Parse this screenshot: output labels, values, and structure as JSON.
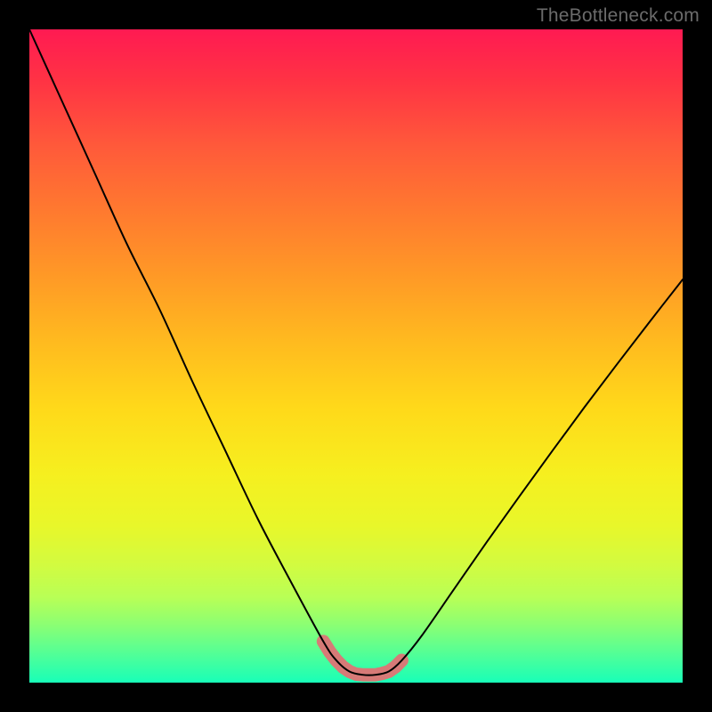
{
  "watermark": "TheBottleneck.com",
  "chart_data": {
    "type": "line",
    "title": "",
    "xlabel": "",
    "ylabel": "",
    "xlim": [
      0,
      100
    ],
    "ylim": [
      0,
      100
    ],
    "grid": false,
    "legend": "none",
    "series": [
      {
        "name": "bottleneck-curve",
        "color": "#000000",
        "x": [
          0,
          5,
          10,
          15,
          20,
          25,
          30,
          35,
          40,
          45,
          47,
          49,
          51,
          53,
          55,
          57,
          60,
          65,
          70,
          75,
          80,
          85,
          90,
          95,
          100
        ],
        "y": [
          100,
          89,
          78,
          67,
          57,
          46,
          35.5,
          25,
          15.5,
          6.3,
          3.4,
          1.7,
          1.2,
          1.2,
          1.7,
          3.4,
          7.1,
          14.3,
          21.5,
          28.5,
          35.4,
          42.2,
          48.8,
          55.3,
          61.7
        ]
      },
      {
        "name": "optimal-zone-highlight",
        "color": "#d77a77",
        "x": [
          45.0,
          46.0,
          47.0,
          48.0,
          49.0,
          50.0,
          51.0,
          52.0,
          53.0,
          54.0,
          55.0,
          56.0,
          57.0
        ],
        "y": [
          6.3,
          4.7,
          3.4,
          2.4,
          1.7,
          1.3,
          1.2,
          1.2,
          1.2,
          1.4,
          1.7,
          2.4,
          3.4
        ]
      }
    ],
    "annotations": []
  }
}
